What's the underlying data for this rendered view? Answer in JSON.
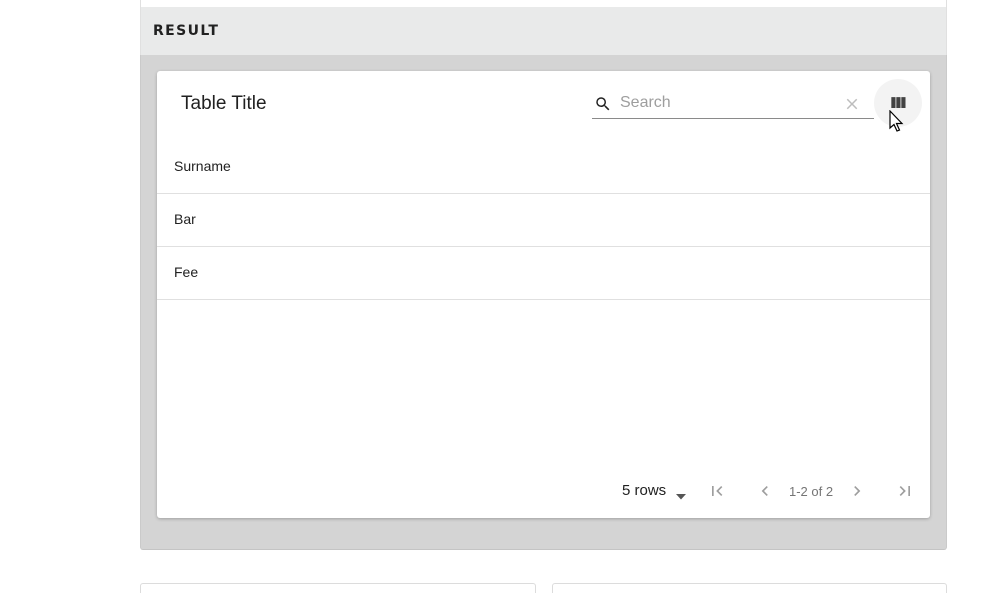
{
  "section": {
    "title": "RESULT"
  },
  "table": {
    "title": "Table Title",
    "search": {
      "placeholder": "Search",
      "value": ""
    },
    "columns": [
      "Surname"
    ],
    "rows": [
      {
        "surname": "Bar"
      },
      {
        "surname": "Fee"
      }
    ]
  },
  "pagination": {
    "rows_per_page": "5 rows",
    "range_label": "1-2 of 2"
  },
  "icons": {
    "search": "search-icon",
    "clear": "clear-icon",
    "columns": "view-column-icon",
    "first_page": "first-page-icon",
    "previous_page": "chevron-left-icon",
    "next_page": "chevron-right-icon",
    "last_page": "last-page-icon",
    "dropdown": "arrow-drop-down-icon"
  },
  "colors": {
    "section_header_bg": "#e9eaea",
    "section_body_bg": "#d4d4d4",
    "card_bg": "#ffffff",
    "divider": "#e0e0e0",
    "muted_icon": "#bdbdbd"
  }
}
